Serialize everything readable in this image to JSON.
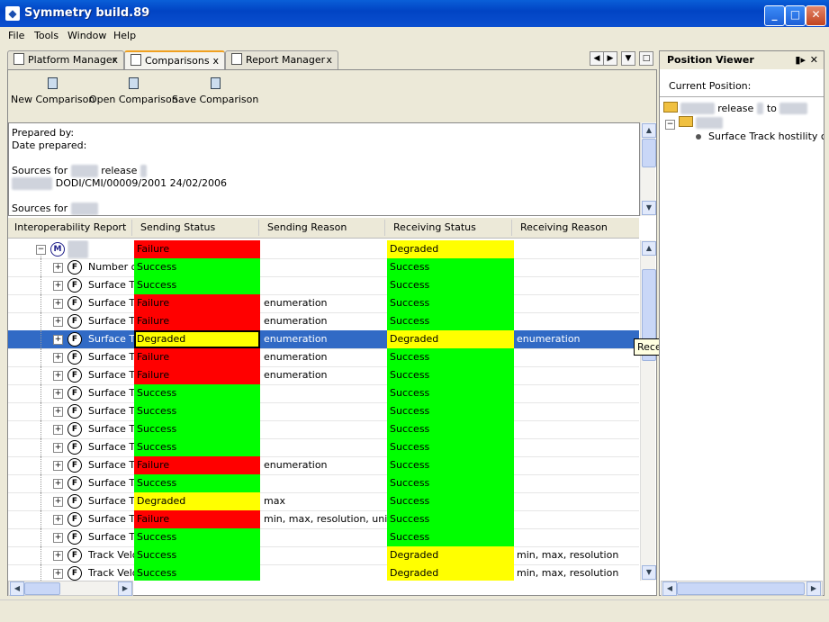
{
  "window": {
    "title": "Symmetry build.89"
  },
  "menu": [
    "File",
    "Tools",
    "Window",
    "Help"
  ],
  "tabs": [
    {
      "label": "Platform Manager",
      "close": "x"
    },
    {
      "label": "Comparisons",
      "close": "x"
    },
    {
      "label": "Report Manager",
      "close": "x"
    }
  ],
  "toolbar": [
    "New Comparison",
    "Open Comparison",
    "Save Comparison"
  ],
  "info": {
    "prepared_by": "Prepared by:",
    "date_prepared": "Date prepared:",
    "sources_label": "Sources for",
    "release_word": "release",
    "doc_ref": "DODI/CMI/00009/2001 24/02/2006",
    "sources_label2": "Sources for"
  },
  "columns": [
    "Interoperability Report",
    "Sending Status",
    "Sending Reason",
    "Receiving Status",
    "Receiving Reason"
  ],
  "rows": [
    {
      "icon": "M",
      "name": "",
      "send": "Failure",
      "sreason": "",
      "recv": "Degraded",
      "rreason": ""
    },
    {
      "icon": "F",
      "name": "Number of t",
      "send": "Success",
      "sreason": "",
      "recv": "Success",
      "rreason": ""
    },
    {
      "icon": "F",
      "name": "Surface Trac",
      "send": "Success",
      "sreason": "",
      "recv": "Success",
      "rreason": ""
    },
    {
      "icon": "F",
      "name": "Surface Trac",
      "send": "Failure",
      "sreason": "enumeration",
      "recv": "Success",
      "rreason": ""
    },
    {
      "icon": "F",
      "name": "Surface Trac",
      "send": "Failure",
      "sreason": "enumeration",
      "recv": "Success",
      "rreason": ""
    },
    {
      "icon": "F",
      "name": "Surface Trac",
      "send": "Degraded",
      "sreason": "enumeration",
      "recv": "Degraded",
      "rreason": "enumeration",
      "selected": true
    },
    {
      "icon": "F",
      "name": "Surface Trac",
      "send": "Failure",
      "sreason": "enumeration",
      "recv": "Success",
      "rreason": ""
    },
    {
      "icon": "F",
      "name": "Surface Trac",
      "send": "Failure",
      "sreason": "enumeration",
      "recv": "Success",
      "rreason": ""
    },
    {
      "icon": "F",
      "name": "Surface Trac",
      "send": "Success",
      "sreason": "",
      "recv": "Success",
      "rreason": ""
    },
    {
      "icon": "F",
      "name": "Surface Trac",
      "send": "Success",
      "sreason": "",
      "recv": "Success",
      "rreason": ""
    },
    {
      "icon": "F",
      "name": "Surface Trac",
      "send": "Success",
      "sreason": "",
      "recv": "Success",
      "rreason": ""
    },
    {
      "icon": "F",
      "name": "Surface Trac",
      "send": "Success",
      "sreason": "",
      "recv": "Success",
      "rreason": ""
    },
    {
      "icon": "F",
      "name": "Surface Trac",
      "send": "Failure",
      "sreason": "enumeration",
      "recv": "Success",
      "rreason": ""
    },
    {
      "icon": "F",
      "name": "Surface Trac",
      "send": "Success",
      "sreason": "",
      "recv": "Success",
      "rreason": ""
    },
    {
      "icon": "F",
      "name": "Surface Trac",
      "send": "Degraded",
      "sreason": "max",
      "recv": "Success",
      "rreason": ""
    },
    {
      "icon": "F",
      "name": "Surface Trac",
      "send": "Failure",
      "sreason": "min, max, resolution, units",
      "recv": "Success",
      "rreason": ""
    },
    {
      "icon": "F",
      "name": "Surface Trac",
      "send": "Success",
      "sreason": "",
      "recv": "Success",
      "rreason": ""
    },
    {
      "icon": "F",
      "name": "Track Velocit",
      "send": "Success",
      "sreason": "",
      "recv": "Degraded",
      "rreason": "min, max, resolution"
    },
    {
      "icon": "F",
      "name": "Track Velocit",
      "send": "Success",
      "sreason": "",
      "recv": "Degraded",
      "rreason": "min, max, resolution"
    }
  ],
  "tooltip": "Receiving Reason",
  "side": {
    "title": "Position Viewer",
    "current_position": "Current Position:",
    "root_mid": "release",
    "root_to": "to",
    "leaf": "Surface Track hostility co"
  },
  "colors": {
    "failure": "#ff0000",
    "success": "#00ff00",
    "degraded": "#ffff00",
    "selected": "#316ac5"
  }
}
